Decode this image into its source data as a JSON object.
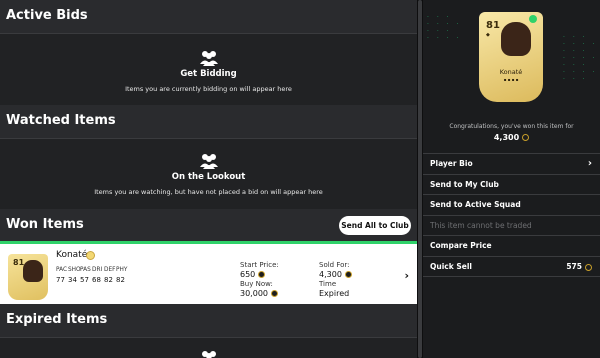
{
  "active_bids": {
    "title": "Active Bids",
    "empty_heading": "Get Bidding",
    "empty_text": "Items you are currently bidding on will appear here"
  },
  "watched_items": {
    "title": "Watched Items",
    "empty_heading": "On the Lookout",
    "empty_text": "Items you are watching, but have not placed a bid on will appear here"
  },
  "won_items": {
    "title": "Won Items",
    "send_all_label": "Send All to Club",
    "item": {
      "rating": "81",
      "name": "Konaté",
      "stat_labels": [
        "PAC",
        "SHO",
        "PAS",
        "DRI",
        "DEF",
        "PHY"
      ],
      "stat_values": [
        "77",
        "34",
        "57",
        "68",
        "82",
        "82"
      ],
      "start_price_label": "Start Price:",
      "start_price": "650",
      "buy_now_label": "Buy Now:",
      "buy_now": "30,000",
      "sold_for_label": "Sold For:",
      "sold_for": "4,300",
      "time_label": "Time",
      "time_value": "Expired"
    }
  },
  "expired_items": {
    "title": "Expired Items"
  },
  "detail_panel": {
    "card": {
      "rating": "81",
      "name": "Konaté"
    },
    "congrats_text": "Congratulations, you've won this item for",
    "won_price": "4,300",
    "menu": [
      {
        "label": "Player Bio",
        "enabled": true
      },
      {
        "label": "Send to My Club",
        "enabled": true
      },
      {
        "label": "Send to Active Squad",
        "enabled": true
      },
      {
        "label": "This item cannot be traded",
        "enabled": false
      },
      {
        "label": "Compare Price",
        "enabled": true
      },
      {
        "label": "Quick Sell",
        "enabled": true
      }
    ],
    "quick_sell_value": "575"
  },
  "colors": {
    "won_accent": "#2fd26a",
    "card_gold": "#e0c060",
    "dots_green": "#1fa866"
  }
}
